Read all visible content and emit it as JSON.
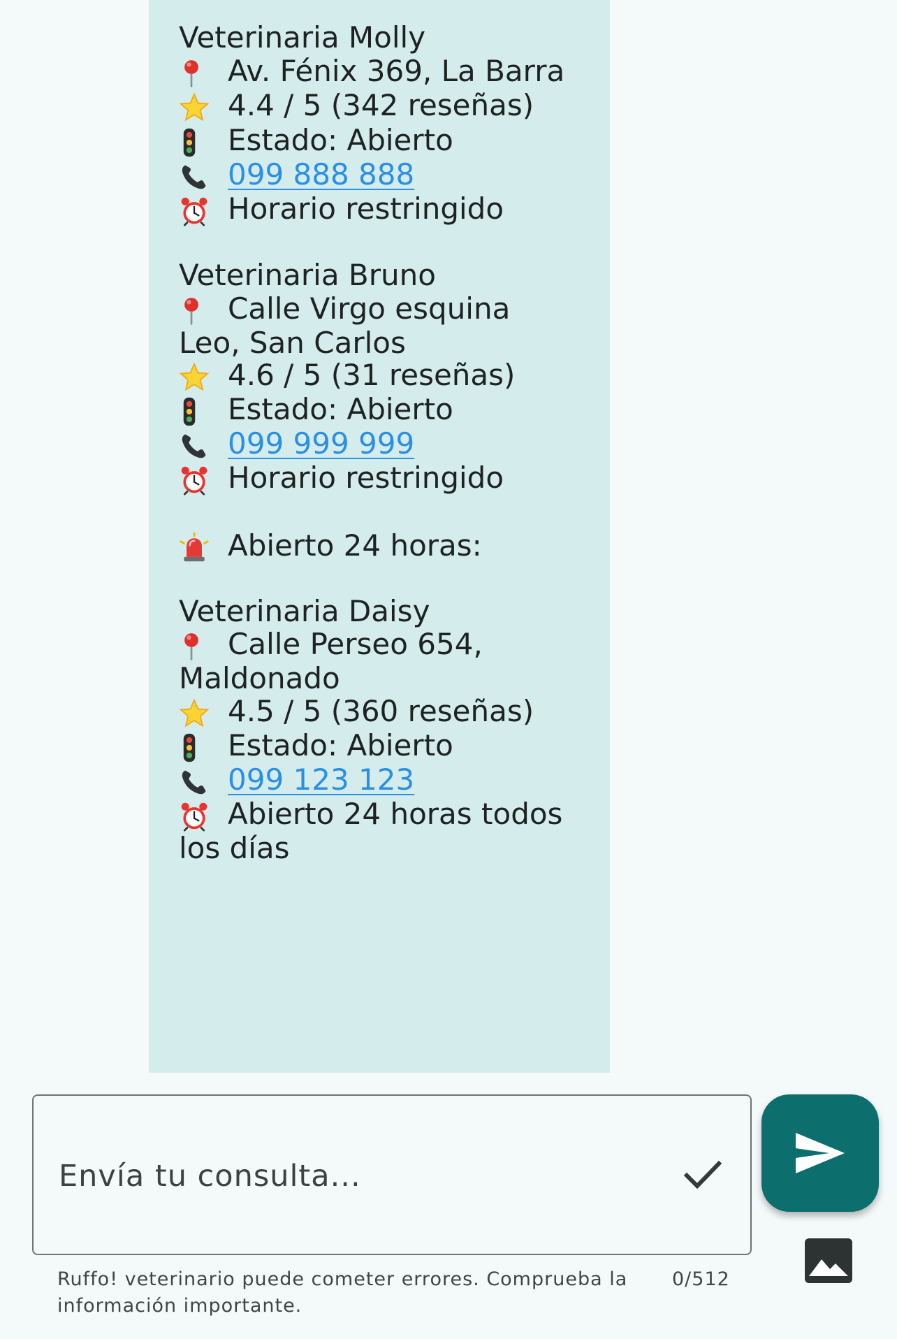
{
  "vets": [
    {
      "name": "Veterinaria Molly",
      "address": "Av. Fénix 369, La Barra",
      "rating": "4.4 / 5 (342 reseñas)",
      "status": "Estado: Abierto",
      "phone": "099 888 888",
      "hours": "Horario restringido"
    },
    {
      "name": "Veterinaria Bruno",
      "address_line1": "Calle Virgo esquina",
      "address_line2": "Leo, San Carlos",
      "rating": "4.6 / 5 (31 reseñas)",
      "status": "Estado: Abierto",
      "phone": "099 999 999",
      "hours": "Horario restringido"
    }
  ],
  "section_24h": "Abierto 24 horas:",
  "vet_24h": {
    "name": "Veterinaria Daisy",
    "address_line1": "Calle Perseo 654,",
    "address_line2": "Maldonado",
    "rating": "4.5 / 5 (360 reseñas)",
    "status": "Estado: Abierto",
    "phone": "099 123 123",
    "hours_line1": "Abierto 24 horas todos",
    "hours_line2": "los días"
  },
  "input": {
    "placeholder": "Envía tu consulta..."
  },
  "footer": {
    "disclaimer": "Ruffo! veterinario puede cometer errores. Comprueba la información importante.",
    "counter": "0/512"
  },
  "icons": {
    "address": "pin-icon",
    "rating": "star-icon",
    "status": "traffic-light-icon",
    "phone": "phone-icon",
    "hours": "alarm-clock-icon",
    "emergency": "siren-icon",
    "send": "send-icon",
    "image": "image-icon",
    "check": "check-icon"
  },
  "colors": {
    "bubble": "#d4ecec",
    "link": "#2b8fe4",
    "send_button": "#0d6e6e",
    "background": "#f4f9f9"
  }
}
